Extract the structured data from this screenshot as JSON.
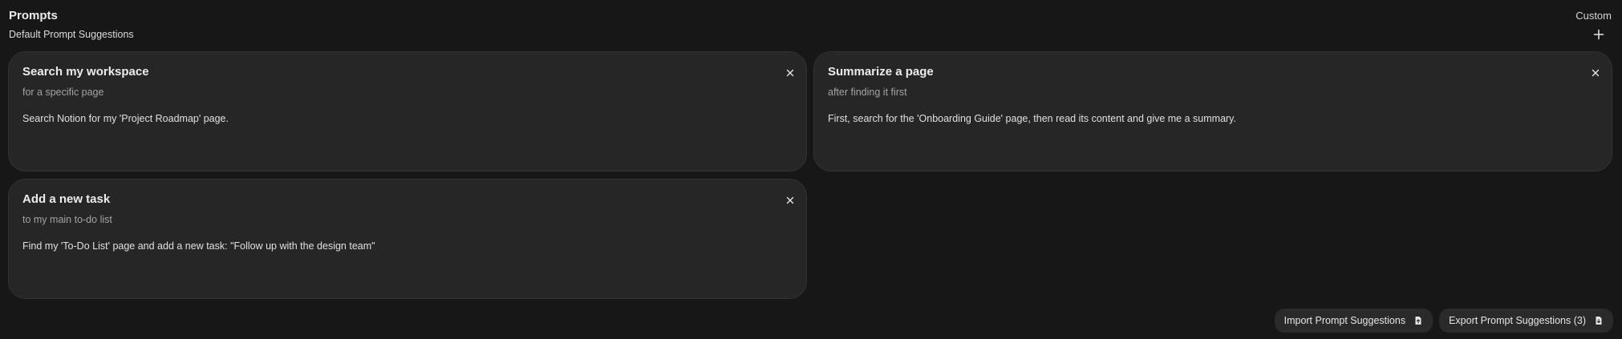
{
  "header": {
    "title": "Prompts",
    "mode": "Custom",
    "subtitle": "Default Prompt Suggestions"
  },
  "icons": {
    "add": "plus-icon",
    "remove": "close-icon",
    "import": "file-arrow-up-icon",
    "export": "file-arrow-down-icon"
  },
  "prompts": [
    {
      "title": "Search my workspace",
      "subtitle": "for a specific page",
      "content": "Search Notion for my 'Project Roadmap' page."
    },
    {
      "title": "Summarize a page",
      "subtitle": "after finding it first",
      "content": "First, search for the 'Onboarding Guide' page, then read its content and give me a summary."
    },
    {
      "title": "Add a new task",
      "subtitle": "to my main to-do list",
      "content": "Find my 'To-Do List' page and add a new task: \"Follow up with the design team\""
    }
  ],
  "footer": {
    "import_label": "Import Prompt Suggestions",
    "export_label": "Export Prompt Suggestions (3)"
  }
}
